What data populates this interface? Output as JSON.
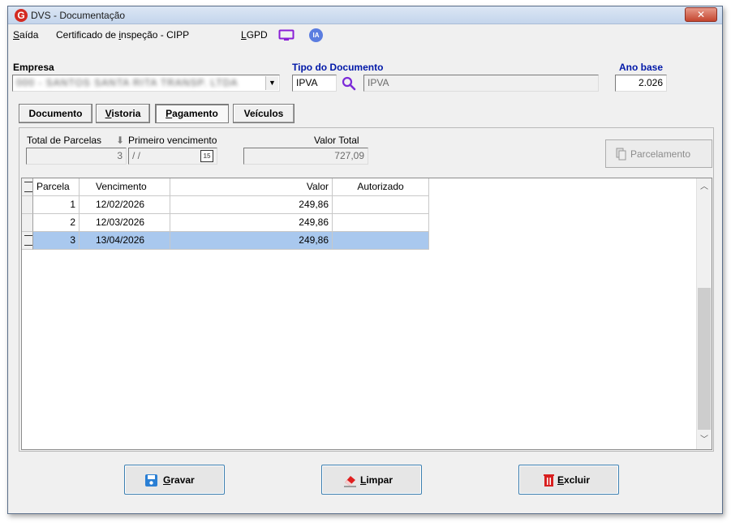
{
  "window": {
    "title": "DVS - Documentação",
    "close_glyph": "✕"
  },
  "menu": {
    "saida": "Saída",
    "saida_u": "S",
    "saida_rest": "aída",
    "cert_a": "Certificado de ",
    "cert_u": "i",
    "cert_b": "nspeção - CIPP",
    "lgpd_u": "L",
    "lgpd_rest": "GPD",
    "ia": "IA"
  },
  "form": {
    "empresa_label": "Empresa",
    "empresa_value": "000 - SANTOS SANTA RITA TRANSP. LTDA",
    "tipo_label": "Tipo do Documento",
    "tipo_code": "IPVA",
    "tipo_desc": "IPVA",
    "ano_label": "Ano base",
    "ano_value": "2.026"
  },
  "tabs": [
    {
      "label": "Documento",
      "active": false
    },
    {
      "label": "Vistoria",
      "u": "V",
      "rest": "istoria",
      "active": false
    },
    {
      "label": "Pagamento",
      "u": "P",
      "rest": "agamento",
      "active": true
    },
    {
      "label": "Veículos",
      "active": false
    }
  ],
  "pagamento": {
    "total_parcelas_label": "Total de Parcelas",
    "total_parcelas_value": "3",
    "primeiro_venc_label": "Primeiro vencimento",
    "primeiro_venc_value": "/ /",
    "calendar_glyph": "15",
    "valor_total_label": "Valor Total",
    "valor_total_value": "727,09",
    "parcelamento_label": "Parcelamento"
  },
  "grid": {
    "columns": [
      "Parcela",
      "Vencimento",
      "Valor",
      "Autorizado"
    ],
    "rows": [
      {
        "parcela": "1",
        "vencimento": "12/02/2026",
        "valor": "249,86",
        "autorizado": ""
      },
      {
        "parcela": "2",
        "vencimento": "12/03/2026",
        "valor": "249,86",
        "autorizado": ""
      },
      {
        "parcela": "3",
        "vencimento": "13/04/2026",
        "valor": "249,86",
        "autorizado": ""
      }
    ]
  },
  "buttons": {
    "gravar_u": "G",
    "gravar_rest": "ravar",
    "limpar_u": "L",
    "limpar_rest": "impar",
    "excluir_u": "E",
    "excluir_rest": "xcluir"
  },
  "colors": {
    "accent": "#0018a8",
    "selection": "#a9c8ee",
    "logo": "#d32a22"
  }
}
